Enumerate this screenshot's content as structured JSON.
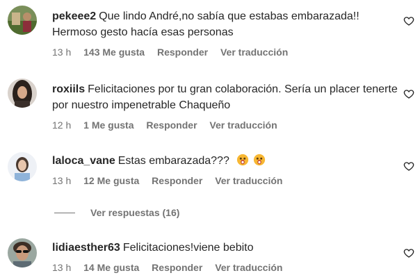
{
  "colors": {
    "text": "#262626",
    "secondary": "#737373",
    "background": "#ffffff"
  },
  "comments": [
    {
      "username": "pekeee2",
      "text": "Que lindo André,no sabía que estabas embarazada!! Hermoso gesto hacía esas personas",
      "time": "13 h",
      "likes": "143 Me gusta",
      "reply": "Responder",
      "translate": "Ver traducción",
      "avatar_icon": "avatar-outdoor-photo",
      "like_icon": "heart-outline-icon"
    },
    {
      "username": "roxiils",
      "text": "Felicitaciones por tu gran colaboración. Sería un placer tenerte por nuestro impenetrable Chaqueño",
      "time": "12 h",
      "likes": "1 Me gusta",
      "reply": "Responder",
      "translate": "Ver traducción",
      "avatar_icon": "avatar-woman-dark-hair",
      "like_icon": "heart-outline-icon"
    },
    {
      "username": "laloca_vane",
      "text": "Estas embarazada???",
      "emojis": [
        "face-with-open-mouth-emoji",
        "face-with-open-mouth-emoji"
      ],
      "time": "13 h",
      "likes": "12 Me gusta",
      "reply": "Responder",
      "translate": "Ver traducción",
      "avatar_icon": "avatar-woman-light",
      "like_icon": "heart-outline-icon"
    },
    {
      "username": "lidiaesther63",
      "text": "Felicitaciones!viene bebito",
      "time": "13 h",
      "likes": "14 Me gusta",
      "reply": "Responder",
      "translate": "Ver traducción",
      "avatar_icon": "avatar-woman-sunglasses",
      "like_icon": "heart-outline-icon"
    }
  ],
  "view_replies": "Ver respuestas (16)"
}
